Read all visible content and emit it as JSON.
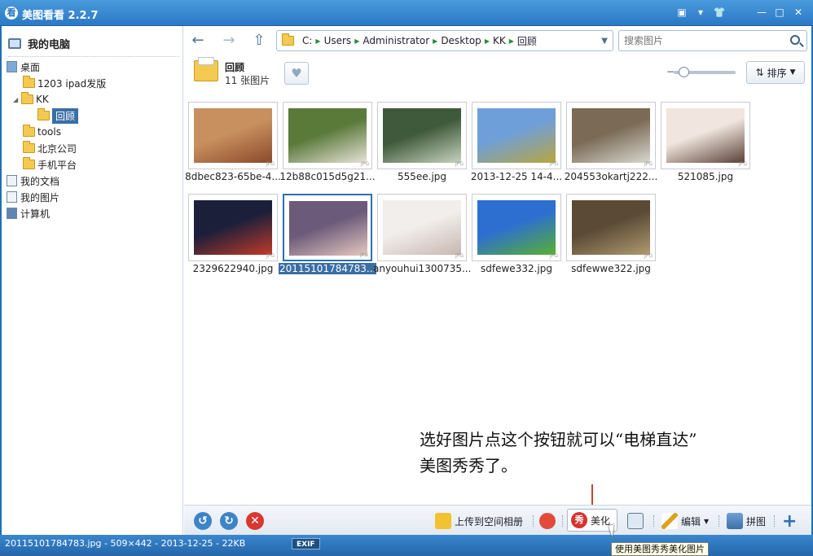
{
  "window": {
    "title": "美图看看 2.2.7",
    "app_icon_glyph": "看",
    "buttons": [
      "feedback-icon",
      "menu-icon",
      "skin-icon",
      "minimize-icon",
      "maximize-icon",
      "close-icon"
    ]
  },
  "sidebar": {
    "header": "我的电脑",
    "items": [
      {
        "label": "桌面",
        "icon": "desktop-icon",
        "level": 0
      },
      {
        "label": "1203 ipad发版",
        "icon": "folder-icon",
        "level": 1
      },
      {
        "label": "KK",
        "icon": "folder-icon",
        "level": 1,
        "expanded": true
      },
      {
        "label": "回顾",
        "icon": "folder-icon",
        "level": 2,
        "selected": true
      },
      {
        "label": "tools",
        "icon": "folder-icon",
        "level": 1
      },
      {
        "label": "北京公司",
        "icon": "folder-icon",
        "level": 1
      },
      {
        "label": "手机平台",
        "icon": "folder-icon",
        "level": 1
      },
      {
        "label": "我的文档",
        "icon": "documents-icon",
        "level": 0
      },
      {
        "label": "我的图片",
        "icon": "pictures-icon",
        "level": 0
      },
      {
        "label": "计算机",
        "icon": "computer-icon",
        "level": 0
      }
    ]
  },
  "address": {
    "crumbs": [
      "C:",
      "Users",
      "Administrator",
      "Desktop",
      "KK",
      "回顾"
    ]
  },
  "search": {
    "placeholder": "搜索图片"
  },
  "folder": {
    "name": "回顾",
    "count": "11 张图片"
  },
  "sort_label": "排序",
  "zoom_level": 0.1,
  "thumbnails": [
    {
      "name": "8dbec823-65be-4...",
      "colors": [
        "#c9905f",
        "#8a4a2a"
      ]
    },
    {
      "name": "12b88c015d5g21...",
      "colors": [
        "#5a7a3a",
        "#e8e2d8"
      ]
    },
    {
      "name": "555ee.jpg",
      "colors": [
        "#3f5a3a",
        "#c8d3c0"
      ]
    },
    {
      "name": "2013-12-25 14-4...",
      "colors": [
        "#6f9fd8",
        "#b8a640"
      ]
    },
    {
      "name": "204553okartj222...",
      "colors": [
        "#7a6a56",
        "#d8d8d0"
      ]
    },
    {
      "name": "521085.jpg",
      "colors": [
        "#f0e6df",
        "#5a4036"
      ]
    },
    {
      "name": "2329622940.jpg",
      "colors": [
        "#1b1f3a",
        "#c23a2a"
      ]
    },
    {
      "name": "20115101784783...",
      "colors": [
        "#6c5a7a",
        "#e6c9c0"
      ],
      "selected": true
    },
    {
      "name": "anyouhui1300735...",
      "colors": [
        "#f2eeec",
        "#c7b7b0"
      ]
    },
    {
      "name": "sdfewe332.jpg",
      "colors": [
        "#2d6fd0",
        "#58b030"
      ]
    },
    {
      "name": "sdfewwe322.jpg",
      "colors": [
        "#5a4a36",
        "#b09a70"
      ]
    }
  ],
  "annotation": {
    "line1": "选好图片点这个按钮就可以“电梯直达”",
    "line2": "美图秀秀了。"
  },
  "bottom": {
    "upload": "上传到空间相册",
    "beautify": "美化",
    "beautify_glyph": "秀",
    "edit": "编辑",
    "collage": "拼图",
    "add_glyph": "+",
    "tooltip": "使用美图秀秀美化图片"
  },
  "status": {
    "info": "20115101784783.jpg - 509×442 - 2013-12-25 - 22KB",
    "exif": "EXIF"
  }
}
